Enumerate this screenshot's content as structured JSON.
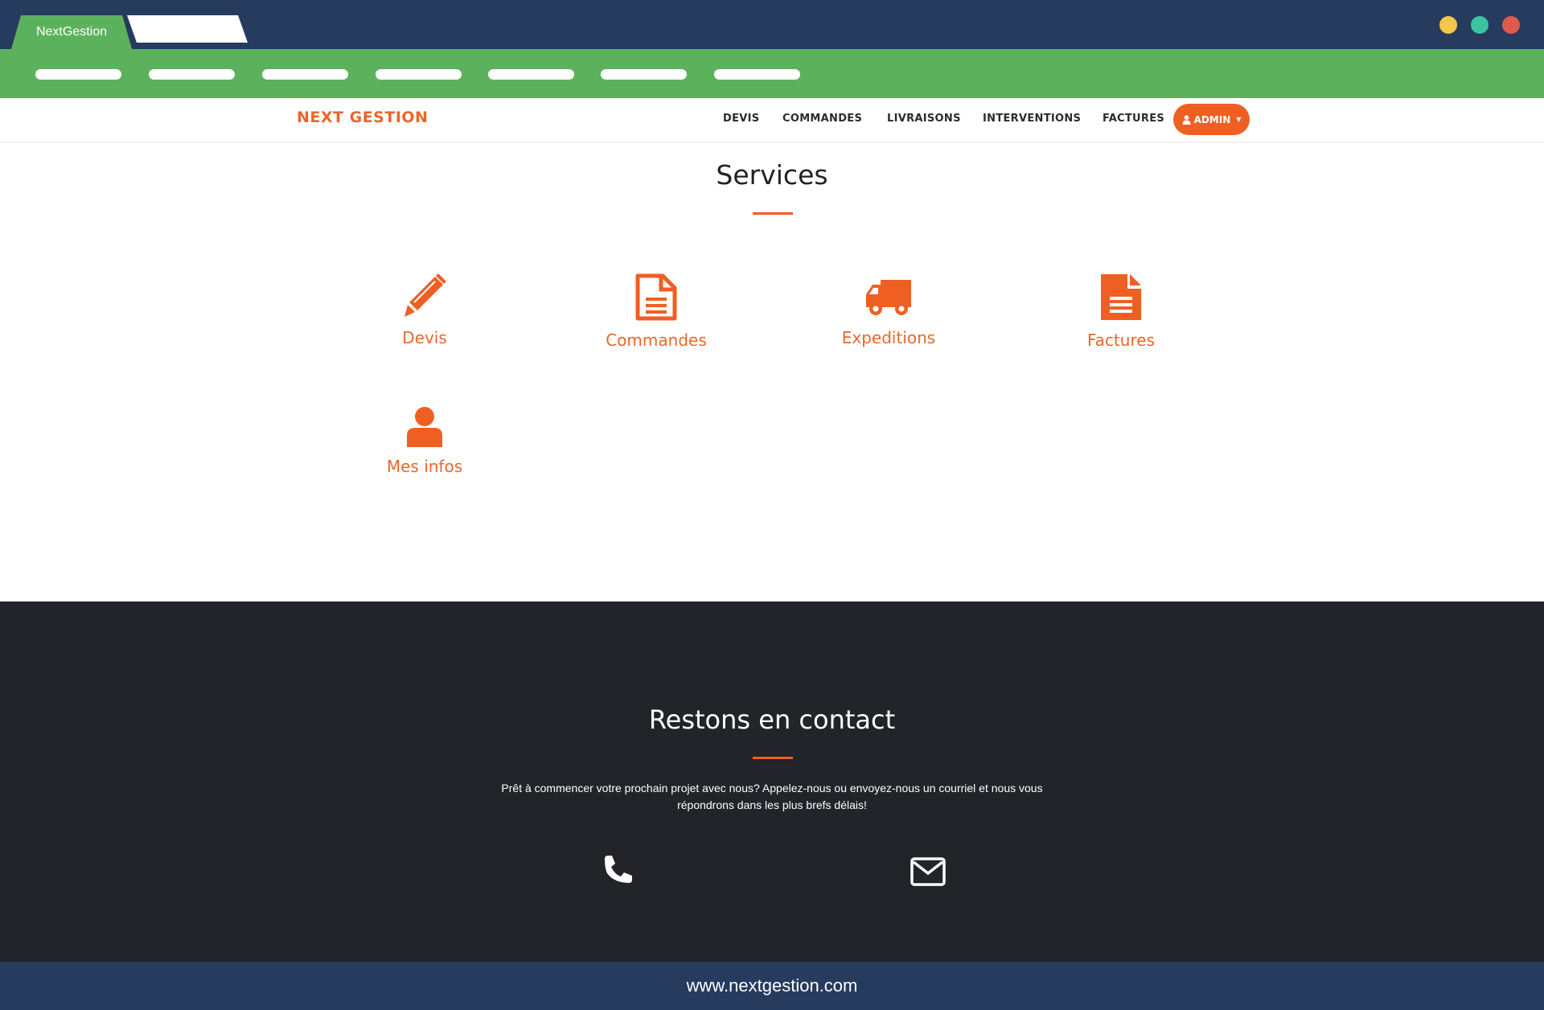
{
  "browser": {
    "tab_active_title": "NextGestion",
    "window_controls": [
      "minimize-dot",
      "maximize-dot",
      "close-dot"
    ]
  },
  "colors": {
    "chrome": "#263b5e",
    "bookmark_bar": "#5cb25c",
    "accent": "#f05f22",
    "brand_text": "#e8672b",
    "contact_bg": "#222429"
  },
  "navbar": {
    "brand": "NEXT GESTION",
    "links": [
      "DEVIS",
      "COMMANDES",
      "LIVRAISONS",
      "INTERVENTIONS",
      "FACTURES"
    ],
    "admin_label": "ADMIN"
  },
  "services": {
    "title": "Services",
    "items": [
      {
        "label": "Devis",
        "icon": "pencil-icon"
      },
      {
        "label": "Commandes",
        "icon": "document-outline-icon"
      },
      {
        "label": "Expeditions",
        "icon": "truck-icon"
      },
      {
        "label": "Factures",
        "icon": "document-filled-icon"
      },
      {
        "label": "Mes infos",
        "icon": "user-icon"
      }
    ]
  },
  "contact": {
    "title": "Restons en contact",
    "text": "Prêt à commencer votre prochain projet avec nous? Appelez-nous ou envoyez-nous un courriel et nous vous répondrons dans les plus brefs délais!",
    "icons": [
      "phone-icon",
      "envelope-icon"
    ]
  },
  "footer": {
    "url": "www.nextgestion.com"
  }
}
